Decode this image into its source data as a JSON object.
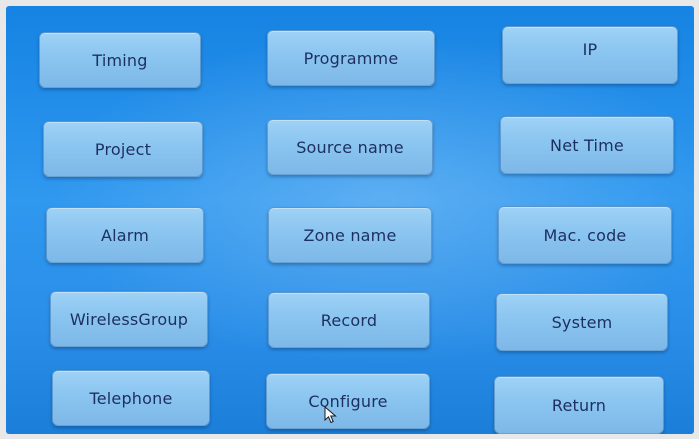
{
  "buttons": {
    "timing": "Timing",
    "programme": "Programme",
    "ip": "IP",
    "project": "Project",
    "source_name": "Source name",
    "net_time": "Net Time",
    "alarm": "Alarm",
    "zone_name": "Zone name",
    "mac_code": "Mac. code",
    "wireless_group": "WirelessGroup",
    "record": "Record",
    "system": "System",
    "telephone": "Telephone",
    "configure": "Configure",
    "return": "Return"
  },
  "colors": {
    "screen_background": "#2a8ee8",
    "button_fill": "#8cc6f1",
    "button_text": "#1d2f5e"
  },
  "icons": {
    "pointer": "mouse-pointer-icon"
  }
}
